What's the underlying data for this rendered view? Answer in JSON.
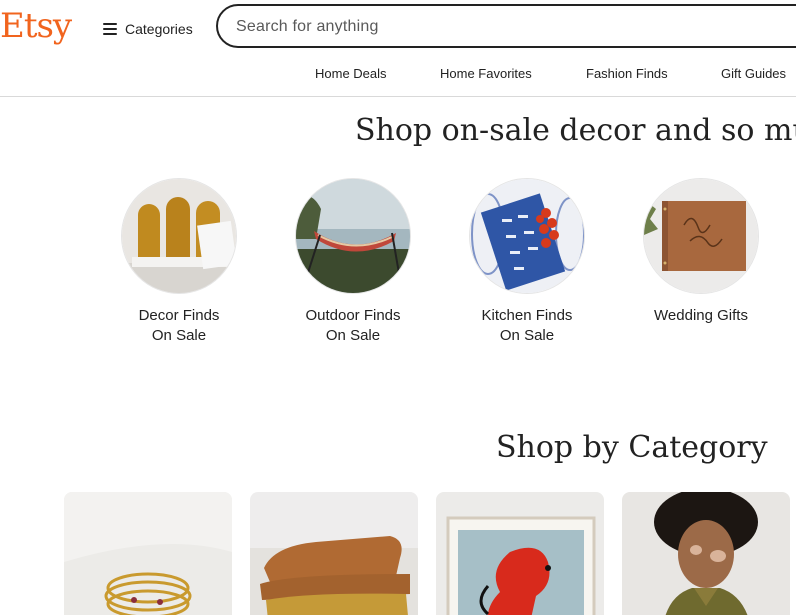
{
  "header": {
    "logo": "Etsy",
    "categories_label": "Categories",
    "search_placeholder": "Search for anything",
    "nav": [
      "Home Deals",
      "Home Favorites",
      "Fashion Finds",
      "Gift Guides"
    ]
  },
  "sale_section": {
    "title": "Shop on-sale decor and so much more",
    "items": [
      {
        "line1": "Decor Finds",
        "line2": "On Sale"
      },
      {
        "line1": "Outdoor Finds",
        "line2": "On Sale"
      },
      {
        "line1": "Kitchen Finds",
        "line2": "On Sale"
      },
      {
        "line1": "Wedding Gifts",
        "line2": ""
      }
    ]
  },
  "category_section": {
    "title": "Shop by Category"
  },
  "colors": {
    "brand": "#f1641e",
    "text": "#222222"
  }
}
